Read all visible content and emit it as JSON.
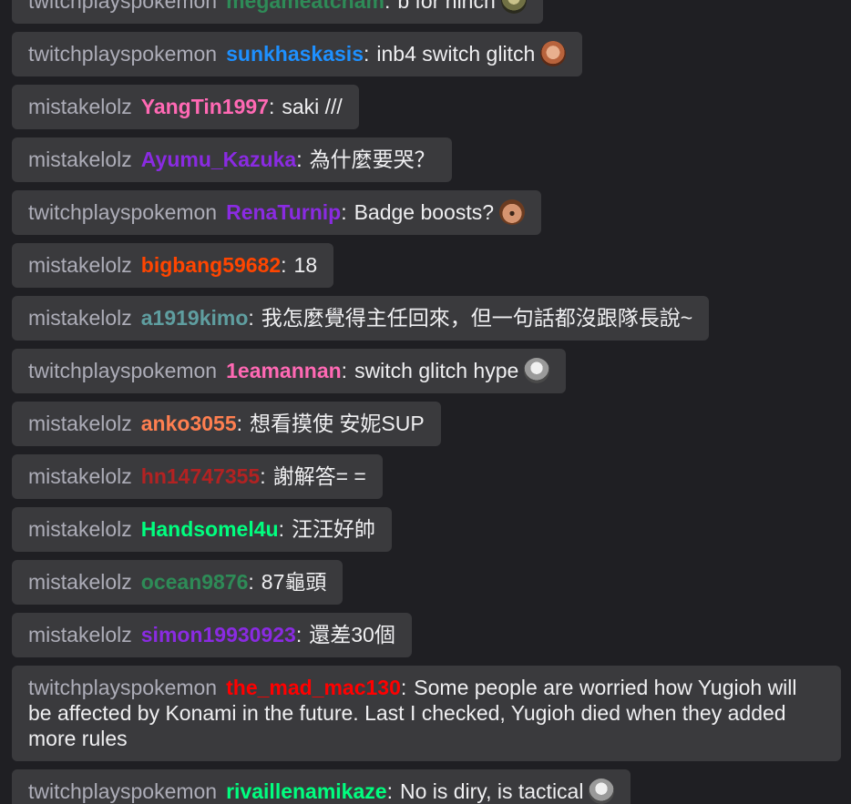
{
  "channels": {
    "tpp": "twitchplayspokemon",
    "mistake": "mistakelolz"
  },
  "colors": {
    "background": "#1f1f23",
    "message_bg": "#3a3a3d",
    "channel_text": "#adadb8",
    "message_text": "#efeff1"
  },
  "messages": [
    {
      "channel": "twitchplayspokemon",
      "user": "megameatcham",
      "user_color": "#2e8b57",
      "text": "b for hinch",
      "emote": "rage-face-icon"
    },
    {
      "channel": "twitchplayspokemon",
      "user": "sunkhaskasis",
      "user_color": "#1e90ff",
      "text": "inb4 switch glitch",
      "emote": "kreygasm-face-icon"
    },
    {
      "channel": "mistakelolz",
      "user": "YangTin1997",
      "user_color": "#ff69b4",
      "text": "saki ///",
      "emote": ""
    },
    {
      "channel": "mistakelolz",
      "user": "Ayumu_Kazuka",
      "user_color": "#8a2be2",
      "text": "為什麼要哭？",
      "emote": ""
    },
    {
      "channel": "twitchplayspokemon",
      "user": "RenaTurnip",
      "user_color": "#8a2be2",
      "text": "Badge boosts?",
      "emote": "pogchamp-face-icon"
    },
    {
      "channel": "mistakelolz",
      "user": "bigbang59682",
      "user_color": "#ff4500",
      "text": "18",
      "emote": ""
    },
    {
      "channel": "mistakelolz",
      "user": "a1919kimo",
      "user_color": "#5f9ea0",
      "text": "我怎麼覺得主任回來，但一句話都沒跟隊長說~",
      "emote": ""
    },
    {
      "channel": "twitchplayspokemon",
      "user": "1eamannan",
      "user_color": "#ff69b4",
      "text": "switch glitch hype",
      "emote": "kappa-face-icon"
    },
    {
      "channel": "mistakelolz",
      "user": "anko3055",
      "user_color": "#ff7f50",
      "text": "想看摸使 安妮SUP",
      "emote": ""
    },
    {
      "channel": "mistakelolz",
      "user": "hn14747355",
      "user_color": "#b22222",
      "text": "謝解答= =",
      "emote": ""
    },
    {
      "channel": "mistakelolz",
      "user": "Handsomel4u",
      "user_color": "#00ff7f",
      "text": "汪汪好帥",
      "emote": ""
    },
    {
      "channel": "mistakelolz",
      "user": "ocean9876",
      "user_color": "#2e8b57",
      "text": "87龜頭",
      "emote": ""
    },
    {
      "channel": "mistakelolz",
      "user": "simon19930923",
      "user_color": "#8a2be2",
      "text": "還差30個",
      "emote": ""
    },
    {
      "channel": "twitchplayspokemon",
      "user": "the_mad_mac130",
      "user_color": "#ff0000",
      "text": "Some people are worried how Yugioh will be affected by Konami in the future. Last I checked, Yugioh died when they added more rules",
      "emote": ""
    },
    {
      "channel": "twitchplayspokemon",
      "user": "rivaillenamikaze",
      "user_color": "#00ff7f",
      "text": "No is diry, is tactical",
      "emote": "kappa-face-icon"
    }
  ]
}
